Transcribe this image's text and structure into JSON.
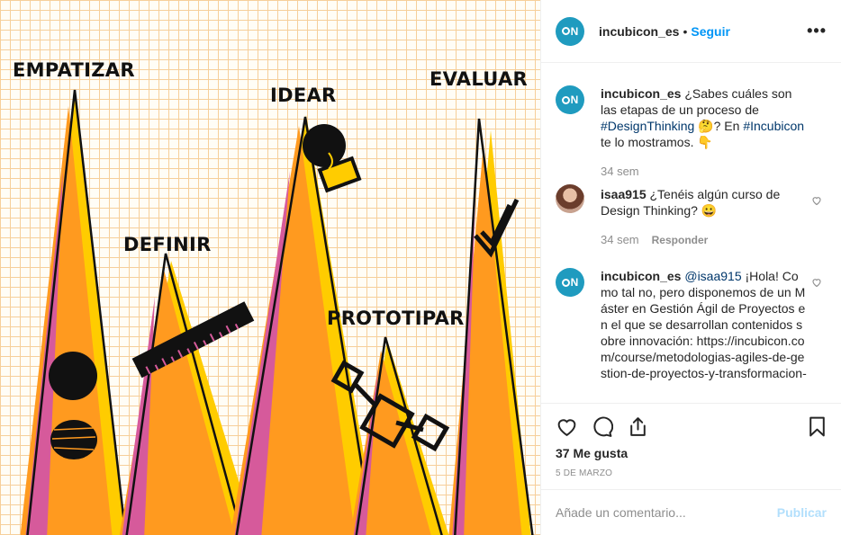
{
  "post": {
    "image": {
      "labels": {
        "empathize": "EMPATIZAR",
        "define": "DEFINIR",
        "ideate": "IDEAR",
        "prototype": "PROTOTIPAR",
        "evaluate": "EVALUAR"
      },
      "colors": {
        "orange": "#ff9a1f",
        "yellow": "#ffcc00",
        "magenta": "#d65a9b",
        "grid": "#f6cf9a"
      }
    },
    "header": {
      "avatar_text": "N",
      "username": "incubicon_es",
      "separator": "•",
      "follow_label": "Seguir",
      "more_label": "•••"
    },
    "caption": {
      "username": "incubicon_es",
      "text_1": "¿Sabes cuáles son las etapas de un proceso de",
      "tag_1": "#DesignThinking",
      "emoji_1": "🤔",
      "text_2": "? En",
      "tag_2": "#Incubicon",
      "text_3": "te lo mostramos.",
      "emoji_2": "👇",
      "time": "34 sem"
    },
    "comments": [
      {
        "username": "isaa915",
        "text": "¿Tenéis algún curso de Design Thinking?",
        "emoji": "😀",
        "time": "34 sem",
        "reply_label": "Responder"
      },
      {
        "username": "incubicon_es",
        "mention": "@isaa915",
        "text": "¡Hola! Como tal no, pero disponemos de un Máster en Gestión Ágil de Proyectos en el que se desarrollan contenidos sobre innovación: https://incubicon.com/course/metodologias-agiles-de-gestion-de-proyectos-y-transformacion-"
      }
    ],
    "likes": "37 Me gusta",
    "date": "5 DE MARZO",
    "add_comment": {
      "placeholder": "Añade un comentario...",
      "publish_label": "Publicar"
    }
  }
}
